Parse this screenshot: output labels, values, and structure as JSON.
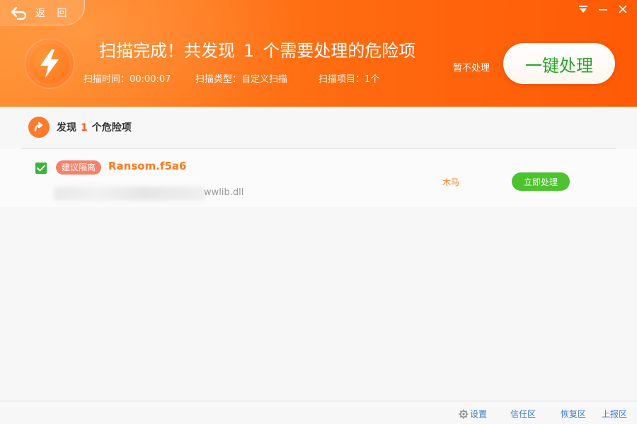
{
  "header": {
    "back_label": "返 回",
    "title_prefix": "扫描完成！共发现",
    "title_count": "1",
    "title_suffix": "个需要处理的危险项",
    "scan_time": "扫描时间：00:00:07",
    "scan_type": "扫描类型：自定义扫描",
    "scan_items": "扫描项目：1个",
    "later_label": "暂不处理",
    "one_key_label": "一键处理"
  },
  "section": {
    "prefix": "发现",
    "count": "1",
    "suffix": "个危险项"
  },
  "items": [
    {
      "badge": "建议隔离",
      "name": "Ransom.f5a6",
      "path_visible": "wwlib.dll",
      "type": "木马",
      "action": "立即处理",
      "checked": true
    }
  ],
  "footer": {
    "settings": "设置",
    "trust": "信任区",
    "restore": "恢复区",
    "report": "上报区"
  },
  "colors": {
    "header": "#ff6a10",
    "accent_orange": "#ff7b1e",
    "green": "#4cc32f",
    "link_blue": "#3a7bd5"
  }
}
